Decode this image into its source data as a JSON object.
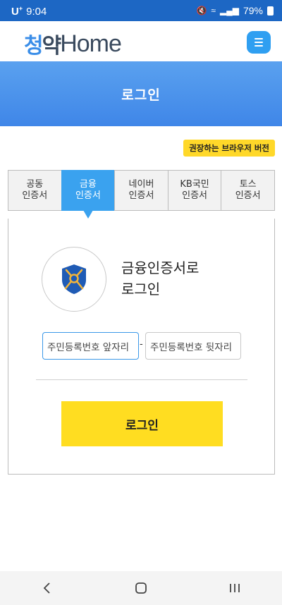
{
  "status_bar": {
    "carrier": "U",
    "carrier_sup": "+",
    "time": "9:04",
    "battery": "79%"
  },
  "header": {
    "logo_hangul_left": "청",
    "logo_hangul_right": "약",
    "logo_latin": "Home"
  },
  "banner": {
    "title": "로그인"
  },
  "browser_badge": "권장하는 브라우저 버전",
  "tabs": [
    {
      "line1": "공동",
      "line2": "인증서",
      "active": false
    },
    {
      "line1": "금융",
      "line2": "인증서",
      "active": true
    },
    {
      "line1": "네이버",
      "line2": "인증서",
      "active": false
    },
    {
      "line1": "KB국민",
      "line2": "인증서",
      "active": false
    },
    {
      "line1": "토스",
      "line2": "인증서",
      "active": false
    }
  ],
  "panel": {
    "title_line1": "금융인증서로",
    "title_line2": "로그인",
    "rrn_front_placeholder": "주민등록번호 앞자리",
    "rrn_separator": "-",
    "rrn_back_placeholder": "주민등록번호 뒷자리",
    "login_button": "로그인"
  },
  "colors": {
    "status_bar": "#1d67c4",
    "accent_blue": "#3aa2ef",
    "banner": "#4a92eb",
    "yellow": "#ffdd21",
    "shield": "#1f5bb5",
    "key": "#f2b43a"
  },
  "icons": {
    "menu": "hamburger-menu-icon",
    "cert": "key-shield-icon",
    "nav_back": "chevron-left-icon",
    "nav_home": "home-square-icon",
    "nav_recent": "recent-apps-icon"
  }
}
